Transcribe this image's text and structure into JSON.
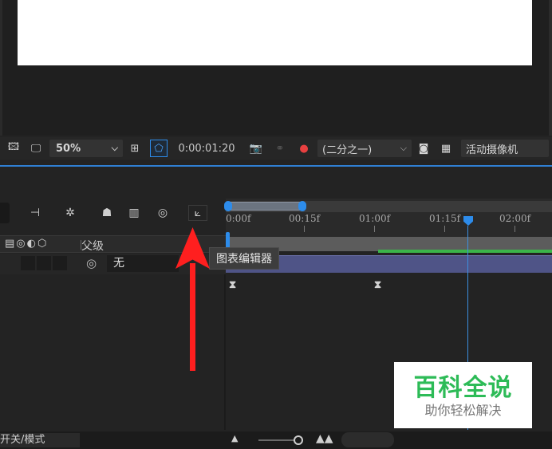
{
  "viewer_toolbar": {
    "zoom": "50%",
    "timecode": "0:00:01:20",
    "resolution": "(二分之一)",
    "camera": "活动摄像机"
  },
  "timeline": {
    "ruler_labels": [
      "0:00f",
      "00:15f",
      "01:00f",
      "01:15f",
      "02:00f"
    ],
    "columns": {
      "parent": "父级"
    },
    "layer": {
      "parent_value": "无"
    },
    "tooltip": "图表编辑器"
  },
  "bottom_bar": {
    "mode_label": "开关/模式"
  },
  "watermark": {
    "title": "百科全说",
    "subtitle": "助你轻松解决"
  },
  "colors": {
    "accent": "#2d8ceb",
    "arrow": "#ff1f1f",
    "layer_bar": "#4f5487",
    "watermark_green": "#2dbb57"
  },
  "icons": [
    "snapshot-icon",
    "monitor-icon",
    "region-icon",
    "mask-toggle-icon",
    "camera-icon",
    "color-channels-icon",
    "graph-editor-icon",
    "motion-blur-icon",
    "draft-3d-icon",
    "shy-icon",
    "frame-blending-icon",
    "brainstorm-icon",
    "pickwhip-icon"
  ]
}
